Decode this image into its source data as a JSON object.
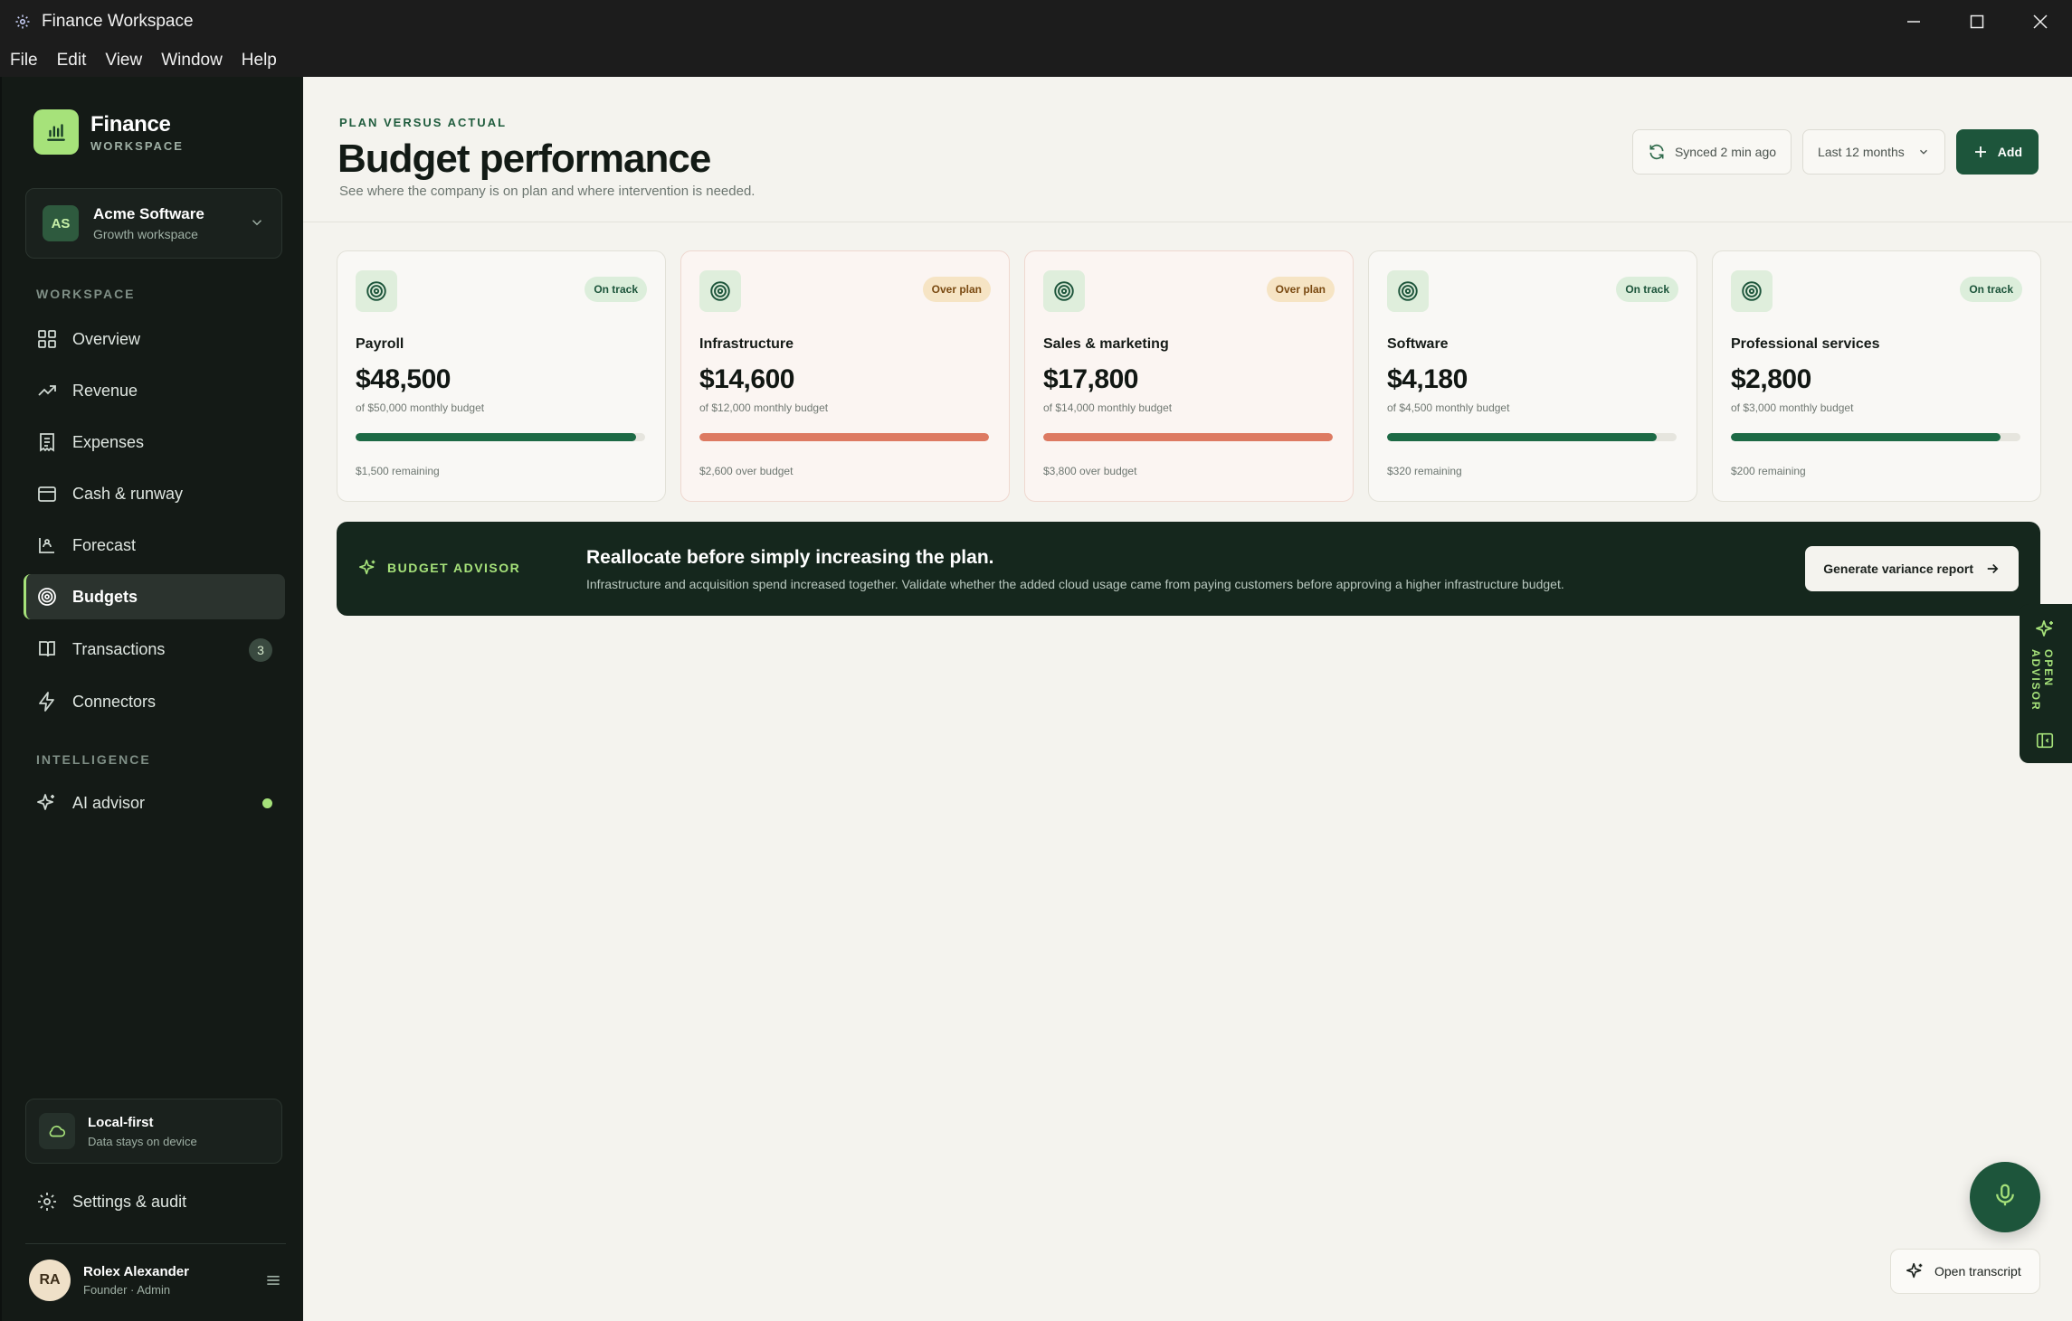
{
  "window": {
    "title": "Finance Workspace"
  },
  "menu": [
    "File",
    "Edit",
    "View",
    "Window",
    "Help"
  ],
  "brand": {
    "name": "Finance",
    "sub": "WORKSPACE"
  },
  "workspace": {
    "initials": "AS",
    "name": "Acme Software",
    "sub": "Growth workspace"
  },
  "sidebar": {
    "section_workspace": "WORKSPACE",
    "section_intelligence": "INTELLIGENCE",
    "items": [
      {
        "label": "Overview",
        "icon": "grid-icon"
      },
      {
        "label": "Revenue",
        "icon": "trend-up-icon"
      },
      {
        "label": "Expenses",
        "icon": "receipt-icon"
      },
      {
        "label": "Cash & runway",
        "icon": "wallet-icon"
      },
      {
        "label": "Forecast",
        "icon": "forecast-icon"
      },
      {
        "label": "Budgets",
        "icon": "target-icon",
        "active": true
      },
      {
        "label": "Transactions",
        "icon": "book-icon",
        "badge": "3"
      },
      {
        "label": "Connectors",
        "icon": "bolt-icon"
      }
    ],
    "ai": {
      "label": "AI advisor",
      "icon": "sparkle-icon",
      "status": "live"
    },
    "local": {
      "title": "Local-first",
      "sub": "Data stays on device"
    },
    "settings": "Settings & audit",
    "user": {
      "initials": "RA",
      "name": "Rolex Alexander",
      "role": "Founder · Admin"
    }
  },
  "header": {
    "eyebrow": "PLAN VERSUS ACTUAL",
    "title": "Budget performance",
    "subtitle": "See where the company is on plan and where intervention is needed.",
    "sync": "Synced 2 min ago",
    "range": "Last 12 months",
    "add": "Add"
  },
  "cards": [
    {
      "name": "Payroll",
      "amount": "$48,500",
      "of": "of $50,000 monthly budget",
      "status": "On track",
      "progress": 0.97,
      "foot": "$1,500 remaining"
    },
    {
      "name": "Infrastructure",
      "amount": "$14,600",
      "of": "of $12,000 monthly budget",
      "status": "Over plan",
      "progress": 1.0,
      "foot": "$2,600 over budget"
    },
    {
      "name": "Sales & marketing",
      "amount": "$17,800",
      "of": "of $14,000 monthly budget",
      "status": "Over plan",
      "progress": 1.0,
      "foot": "$3,800 over budget"
    },
    {
      "name": "Software",
      "amount": "$4,180",
      "of": "of $4,500 monthly budget",
      "status": "On track",
      "progress": 0.93,
      "foot": "$320 remaining"
    },
    {
      "name": "Professional services",
      "amount": "$2,800",
      "of": "of $3,000 monthly budget",
      "status": "On track",
      "progress": 0.93,
      "foot": "$200 remaining"
    }
  ],
  "colors": {
    "ok_fill": "#1d6a45",
    "over_fill": "#dd7a62",
    "accent": "#a6e27a",
    "primary": "#1d553b"
  },
  "advisor": {
    "tag": "BUDGET ADVISOR",
    "headline": "Reallocate before simply increasing the plan.",
    "body": "Infrastructure and acquisition spend increased together. Validate whether the added cloud usage came from paying customers before approving a higher infrastructure budget.",
    "button": "Generate variance report",
    "side_tab": "OPEN ADVISOR"
  },
  "transcript": "Open transcript"
}
